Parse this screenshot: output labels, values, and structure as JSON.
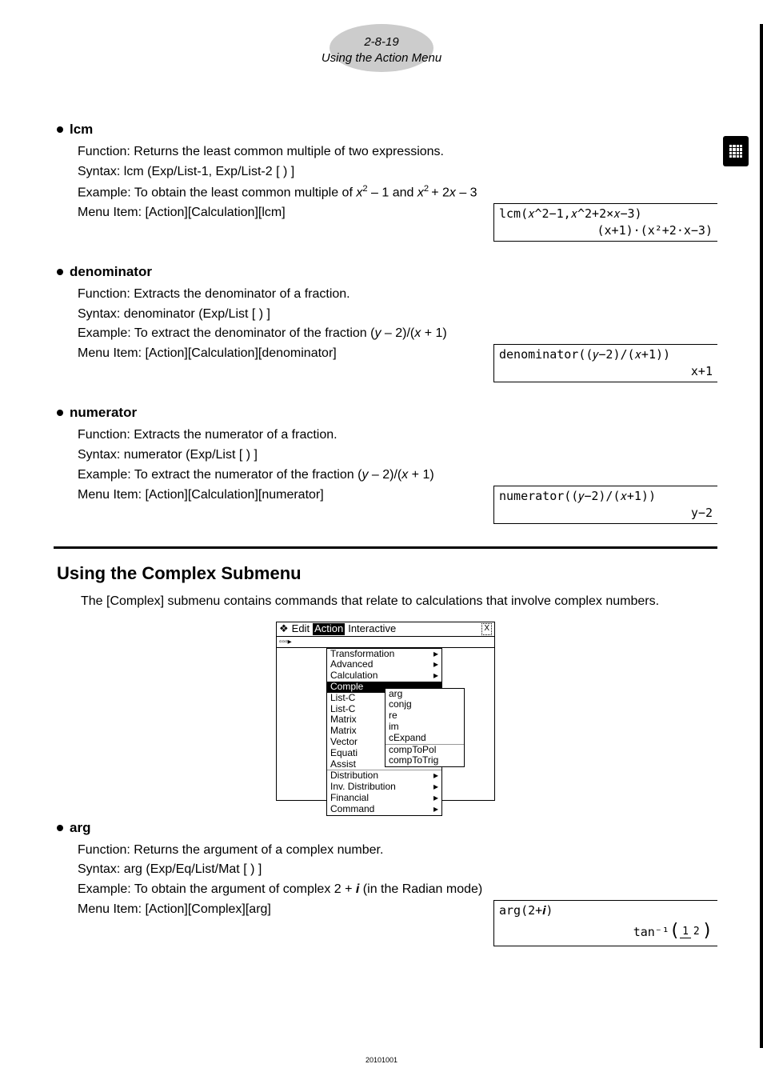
{
  "header": {
    "section_num": "2-8-19",
    "section_title": "Using the Action Menu"
  },
  "lcm": {
    "title": "lcm",
    "function": "Function: Returns the least common multiple of two expressions.",
    "syntax": "Syntax: lcm (Exp/List-1, Exp/List-2 [ ) ]",
    "example_prefix": "Example: To obtain the least common multiple of ",
    "example_mid": " – 1 and ",
    "example_suffix": " – 3",
    "menu": "Menu Item: [Action][Calculation][lcm]",
    "calc_input": "lcm(𝑥^2−1,𝑥^2+2×𝑥−3)",
    "calc_result": "(x+1)·(x²+2·x−3)"
  },
  "denominator": {
    "title": "denominator",
    "function": "Function: Extracts the denominator of a fraction.",
    "syntax": "Syntax: denominator (Exp/List [ ) ]",
    "example_prefix": "Example: To extract the denominator of the fraction (",
    "example_mid": " – 2)/(",
    "example_suffix": " + 1)",
    "menu": "Menu Item: [Action][Calculation][denominator]",
    "calc_input": "denominator((𝑦−2)/(𝑥+1))",
    "calc_result": "x+1"
  },
  "numerator": {
    "title": "numerator",
    "function": "Function: Extracts the numerator of a fraction.",
    "syntax": "Syntax: numerator (Exp/List [ ) ]",
    "example_prefix": "Example: To extract the numerator of the fraction (",
    "example_mid": " – 2)/(",
    "example_suffix": " + 1)",
    "menu": "Menu Item: [Action][Calculation][numerator]",
    "calc_input": "numerator((𝑦−2)/(𝑥+1))",
    "calc_result": "y−2"
  },
  "complex_section": {
    "heading": "Using the Complex Submenu",
    "desc": "The [Complex] submenu contains commands that relate to calculations that involve complex numbers."
  },
  "menu_ui": {
    "bar": {
      "edit": "Edit",
      "action": "Action",
      "interactive": "Interactive"
    },
    "main": [
      "Transformation",
      "Advanced",
      "Calculation",
      "Comple",
      "List-C",
      "List-C",
      "Matrix",
      "Matrix",
      "Vector",
      "Equati",
      "Assist",
      "Distribution",
      "Inv. Distribution",
      "Financial",
      "Command"
    ],
    "sub": [
      "arg",
      "conjg",
      "re",
      "im",
      "cExpand",
      "compToPol",
      "compToTrig"
    ]
  },
  "arg": {
    "title": "arg",
    "function": "Function: Returns the argument of a complex number.",
    "syntax": "Syntax: arg (Exp/Eq/List/Mat [ ) ]",
    "example_prefix": "Example: To obtain the argument of complex 2 + ",
    "example_suffix": " (in the Radian mode)",
    "menu": "Menu Item: [Action][Complex][arg]",
    "calc_input": "arg(2+𝒊)",
    "calc_result_prefix": "tan⁻¹",
    "frac_num": "1",
    "frac_den": "2"
  },
  "footer": "20101001"
}
